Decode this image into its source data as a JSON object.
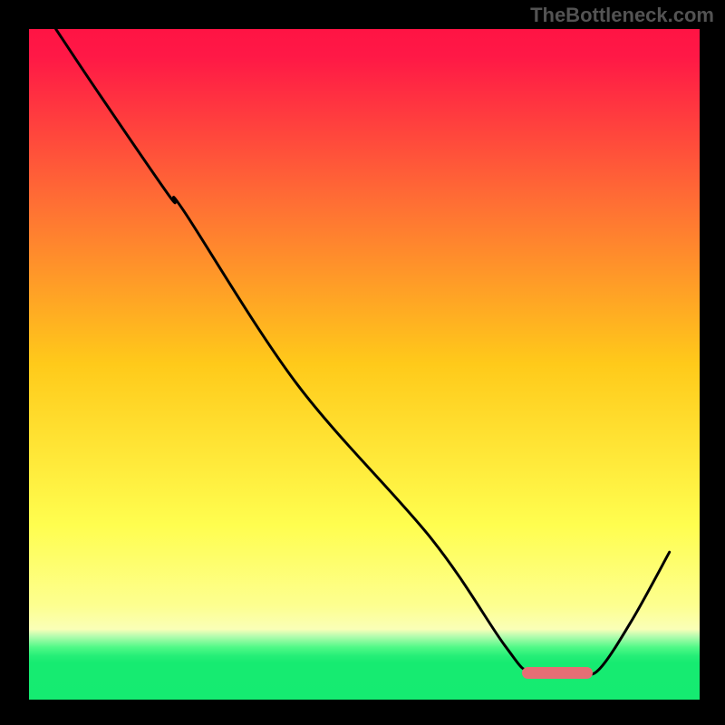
{
  "watermark": "TheBottleneck.com",
  "chart_data": {
    "type": "line",
    "title": "",
    "xlabel": "",
    "ylabel": "",
    "xlim": [
      0,
      100
    ],
    "ylim": [
      0,
      100
    ],
    "grid": false,
    "series": [
      {
        "name": "curve",
        "x": [
          4,
          10,
          21,
          23,
          40,
          60,
          71,
          75,
          82,
          85,
          90,
          95.5
        ],
        "values": [
          100,
          91,
          75,
          73,
          47,
          24,
          8,
          4,
          4,
          4.5,
          12,
          22
        ]
      }
    ],
    "marker": {
      "name": "optimal-range",
      "x_start": 73.5,
      "x_end": 84,
      "y": 4,
      "color": "#E56E75"
    },
    "gradient_stops": [
      {
        "pos": 0.0,
        "color": "#FF1444"
      },
      {
        "pos": 0.04,
        "color": "#FF1846"
      },
      {
        "pos": 0.26,
        "color": "#FF6F34"
      },
      {
        "pos": 0.5,
        "color": "#FFCA1A"
      },
      {
        "pos": 0.74,
        "color": "#FFFE4F"
      },
      {
        "pos": 0.895,
        "color": "#FAFFB7"
      },
      {
        "pos": 0.922,
        "color": "#50F987"
      },
      {
        "pos": 0.945,
        "color": "#16EB71"
      },
      {
        "pos": 1.0,
        "color": "#15EB71"
      }
    ]
  }
}
